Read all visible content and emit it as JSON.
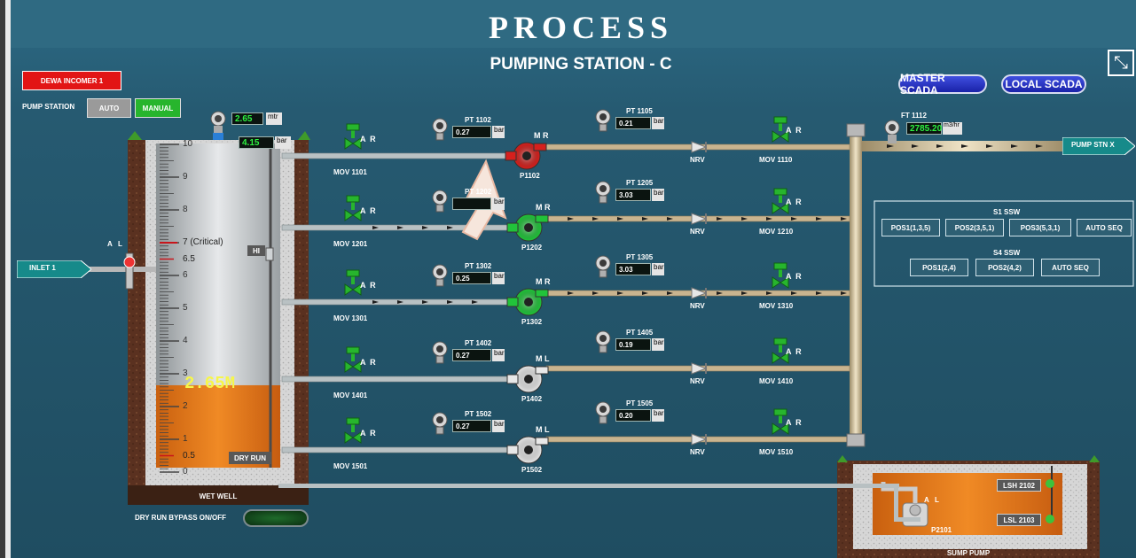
{
  "header": {
    "title": "PROCESS",
    "subtitle": "PUMPING STATION - C"
  },
  "controls": {
    "incomer": "DEWA INCOMER 1",
    "pump_station_label": "PUMP STATION",
    "mode_auto": "AUTO",
    "mode_manual": "MANUAL",
    "master_scada": "MASTER SCADA",
    "local_scada": "LOCAL SCADA",
    "dry_run_bypass": "DRY RUN BYPASS ON/OFF"
  },
  "wet_well": {
    "label": "WET WELL",
    "level_text": "2.65M",
    "level_fraction": 0.265,
    "hi_label": "HI",
    "dry_run_label": "DRY RUN",
    "top_reading": "2.65",
    "top_unit": "mtr",
    "second_reading": "4.15",
    "second_unit": "bar",
    "scale": [
      "10",
      "9",
      "8",
      "7 (Critical)",
      "6.5",
      "6",
      "5",
      "4",
      "3",
      "2",
      "1",
      "0.5",
      "0"
    ]
  },
  "inlet": {
    "label": "INLET 1",
    "a": "A",
    "l": "L"
  },
  "rows": [
    {
      "mov": "MOV 1101",
      "pt": "PT 1102",
      "pt_val": "0.27",
      "pump": "P1102",
      "pump_ml": "M R",
      "pt2": "PT 1105",
      "pt2_val": "0.21",
      "nrv": "NRV",
      "mov2": "MOV 1110",
      "pump_color": "#d6201d"
    },
    {
      "mov": "MOV 1201",
      "pt": "PT 1202",
      "pt_val": "",
      "pump": "P1202",
      "pump_ml": "M R",
      "pt2": "PT 1205",
      "pt2_val": "3.03",
      "nrv": "NRV",
      "mov2": "MOV 1210",
      "pump_color": "#21c43a"
    },
    {
      "mov": "MOV 1301",
      "pt": "PT 1302",
      "pt_val": "0.25",
      "pump": "P1302",
      "pump_ml": "M R",
      "pt2": "PT 1305",
      "pt2_val": "3.03",
      "nrv": "NRV",
      "mov2": "MOV 1310",
      "pump_color": "#21c43a"
    },
    {
      "mov": "MOV 1401",
      "pt": "PT 1402",
      "pt_val": "0.27",
      "pump": "P1402",
      "pump_ml": "M L",
      "pt2": "PT 1405",
      "pt2_val": "0.19",
      "nrv": "NRV",
      "mov2": "MOV 1410",
      "pump_color": "#e8e8e8"
    },
    {
      "mov": "MOV 1501",
      "pt": "PT 1502",
      "pt_val": "0.27",
      "pump": "P1502",
      "pump_ml": "M L",
      "pt2": "PT 1505",
      "pt2_val": "0.20",
      "nrv": "NRV",
      "mov2": "MOV 1510",
      "pump_color": "#e8e8e8"
    }
  ],
  "units": {
    "bar": "bar",
    "ar": "A  R"
  },
  "flow": {
    "tag": "FT 1112",
    "value": "2785.20",
    "unit": "m3/hr",
    "outlet": "PUMP STN X"
  },
  "ssw": {
    "s1_title": "S1 SSW",
    "s1_buttons": [
      "POS1(1,3,5)",
      "POS2(3,5,1)",
      "POS3(5,3,1)",
      "AUTO SEQ"
    ],
    "s4_title": "S4 SSW",
    "s4_buttons": [
      "POS1(2,4)",
      "POS2(4,2)",
      "AUTO SEQ"
    ]
  },
  "sump": {
    "label": "SUMP PUMP",
    "pump": "P2101",
    "lsh": "LSH 2102",
    "lsl": "LSL 2103",
    "a": "A",
    "l": "L"
  },
  "colors": {
    "background": "#254f63",
    "header_top": "#2f6a82",
    "water": "#e07a18",
    "pipe": "#c9b48f",
    "accent_red": "#e2161b",
    "accent_green": "#22b92f"
  }
}
